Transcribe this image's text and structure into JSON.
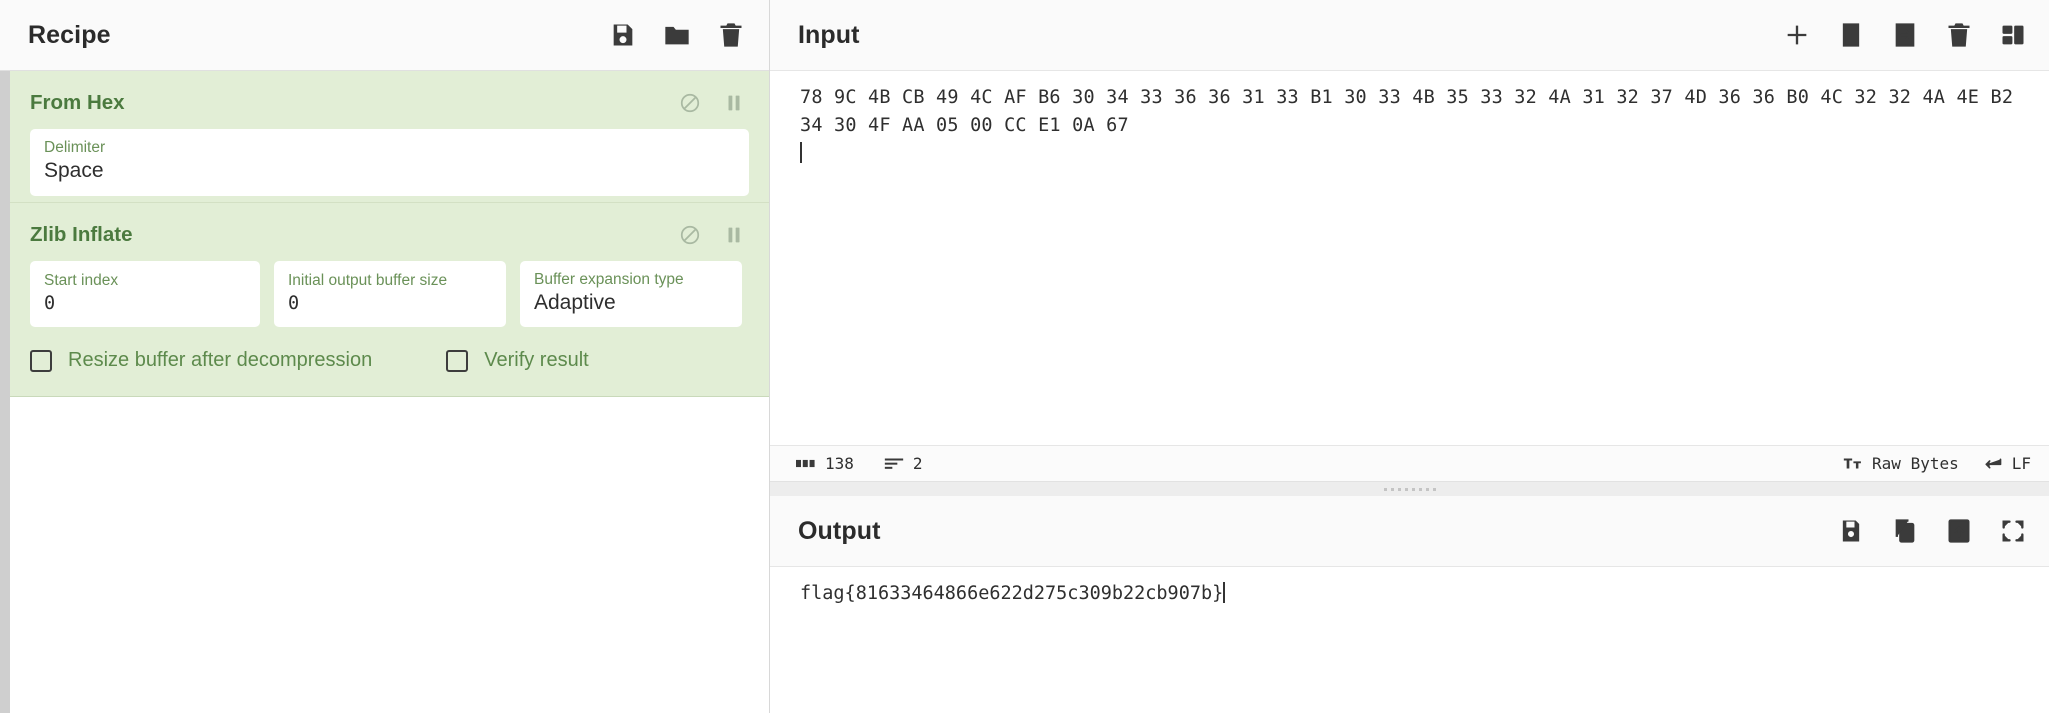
{
  "recipe": {
    "title": "Recipe",
    "toolbar": [
      {
        "name": "save-recipe-icon",
        "label": "Save recipe"
      },
      {
        "name": "load-recipe-icon",
        "label": "Load recipe"
      },
      {
        "name": "clear-recipe-icon",
        "label": "Clear recipe"
      }
    ],
    "operations": [
      {
        "name": "From Hex",
        "controls": [
          {
            "name": "disable-operation-icon",
            "label": "Disable operation"
          },
          {
            "name": "breakpoint-icon",
            "label": "Set breakpoint"
          }
        ],
        "args": [
          {
            "label": "Delimiter",
            "value": "Space",
            "type": "select",
            "full": true
          }
        ],
        "checkboxes": []
      },
      {
        "name": "Zlib Inflate",
        "controls": [
          {
            "name": "disable-operation-icon",
            "label": "Disable operation"
          },
          {
            "name": "breakpoint-icon",
            "label": "Set breakpoint"
          }
        ],
        "args": [
          {
            "label": "Start index",
            "value": "0",
            "type": "number",
            "full": false
          },
          {
            "label": "Initial output buffer size",
            "value": "0",
            "type": "number",
            "full": false
          },
          {
            "label": "Buffer expansion type",
            "value": "Adaptive",
            "type": "select",
            "full": false
          }
        ],
        "checkboxes": [
          {
            "label": "Resize buffer after decompression",
            "checked": false
          },
          {
            "label": "Verify result",
            "checked": false
          }
        ]
      }
    ]
  },
  "input": {
    "title": "Input",
    "toolbar": [
      {
        "name": "add-input-tab-icon",
        "label": "Add a new input tab"
      },
      {
        "name": "open-folder-as-input-icon",
        "label": "Open folder as input"
      },
      {
        "name": "open-file-as-input-icon",
        "label": "Open file as input"
      },
      {
        "name": "clear-input-icon",
        "label": "Clear input and output"
      },
      {
        "name": "reset-pane-layout-icon",
        "label": "Reset pane layout"
      }
    ],
    "lines": [
      "78 9C 4B CB 49 4C AF B6 30 34 33 36 36 31 33 B1 30 33 4B 35 33 32 4A 31 32 37 4D 36 36 B0 4C 32 32 4A 4E B2",
      "34 30 4F AA 05 00 CC E1 0A 67",
      ""
    ],
    "status": {
      "length_icon": "character-count-icon",
      "length": "138",
      "lines_icon": "line-count-icon",
      "lines": "2",
      "encoding_icon": "character-encoding-icon",
      "encoding": "Raw Bytes",
      "line_ending_icon": "line-ending-icon",
      "line_ending": "LF"
    }
  },
  "output": {
    "title": "Output",
    "toolbar": [
      {
        "name": "save-output-icon",
        "label": "Save output to file"
      },
      {
        "name": "copy-output-icon",
        "label": "Copy raw output to clipboard"
      },
      {
        "name": "replace-input-with-output-icon",
        "label": "Replace input with output"
      },
      {
        "name": "maximise-output-icon",
        "label": "Maximise output pane"
      }
    ],
    "text": "flag{81633464866e622d275c309b22cb907b}"
  },
  "theme": {
    "operation_bg": "#e2eed6",
    "operation_title": "#4b7a3f",
    "arg_label": "#6a9158",
    "header_bg": "#fafafa"
  }
}
